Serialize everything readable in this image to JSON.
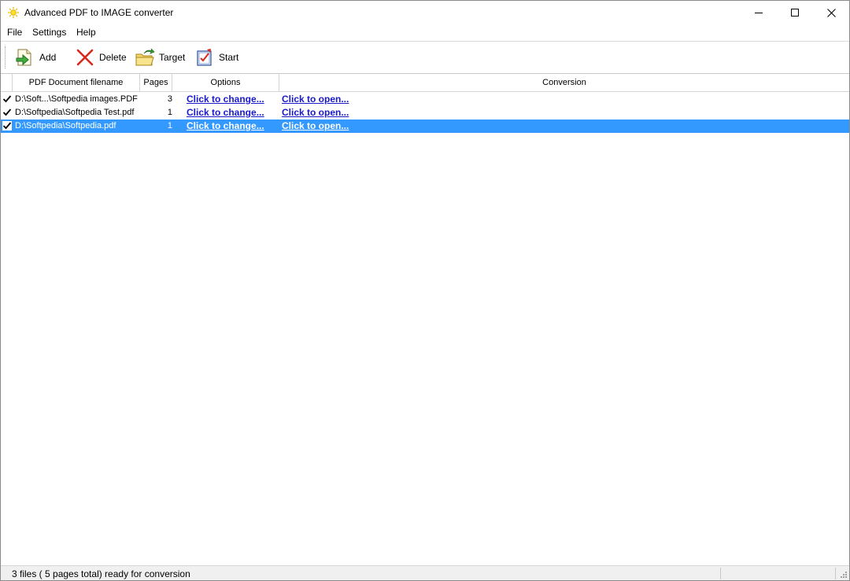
{
  "window": {
    "title": "Advanced PDF to IMAGE converter"
  },
  "menu": {
    "file": "File",
    "settings": "Settings",
    "help": "Help"
  },
  "toolbar": {
    "add": "Add",
    "delete": "Delete",
    "target": "Target",
    "start": "Start"
  },
  "table": {
    "headers": {
      "filename": "PDF Document filename",
      "pages": "Pages",
      "options": "Options",
      "conversion": "Conversion"
    },
    "rows": [
      {
        "checked": true,
        "filename": "D:\\Soft...\\Softpedia images.PDF",
        "pages": "3",
        "options": "Click to change...",
        "conversion": "Click to open...",
        "selected": false
      },
      {
        "checked": true,
        "filename": "D:\\Softpedia\\Softpedia Test.pdf",
        "pages": "1",
        "options": "Click to change...",
        "conversion": "Click to open...",
        "selected": false
      },
      {
        "checked": true,
        "filename": "D:\\Softpedia\\Softpedia.pdf",
        "pages": "1",
        "options": "Click to change...",
        "conversion": "Click to open...",
        "selected": true
      }
    ]
  },
  "status": {
    "text": "3 files ( 5 pages total) ready for conversion"
  },
  "colors": {
    "selection": "#3399ff",
    "link": "#1a1acc",
    "statusbar": "#f0f0f0"
  },
  "icons": {
    "app": "sun-icon",
    "add": "add-document-icon",
    "delete": "red-x-icon",
    "target": "folder-arrow-icon",
    "start": "checklist-icon"
  }
}
